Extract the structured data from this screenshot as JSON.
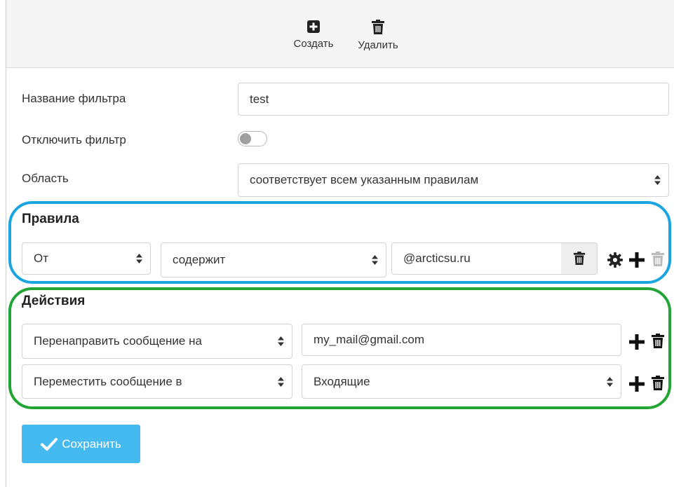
{
  "toolbar": {
    "create_label": "Создать",
    "delete_label": "Удалить"
  },
  "form": {
    "name_label": "Название фильтра",
    "name_value": "test",
    "disable_label": "Отключить фильтр",
    "disable_enabled": false,
    "scope_label": "Область",
    "scope_value": "соответствует всем указанным правилам"
  },
  "rules": {
    "title": "Правила",
    "items": [
      {
        "field": "От",
        "condition": "содержит",
        "value": "@arcticsu.ru"
      }
    ]
  },
  "actions": {
    "title": "Действия",
    "items": [
      {
        "action": "Перенаправить сообщение на",
        "target": "my_mail@gmail.com"
      },
      {
        "action": "Переместить сообщение в",
        "target": "Входящие"
      }
    ]
  },
  "save_label": "Сохранить",
  "colors": {
    "accent": "#45baf0",
    "rules_highlight": "#1aa5e0",
    "actions_highlight": "#22a535"
  }
}
